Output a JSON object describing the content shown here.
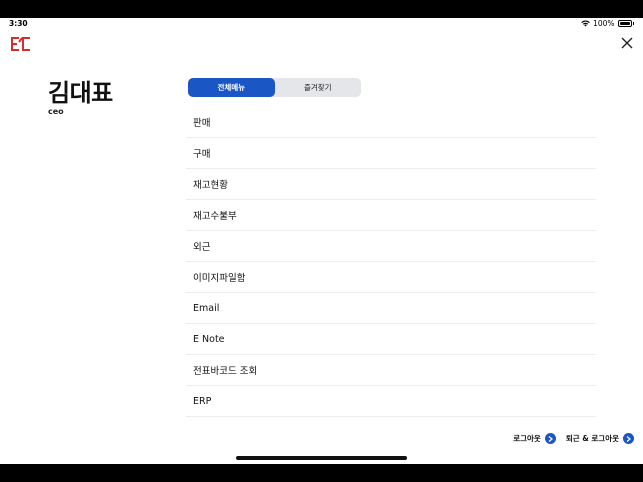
{
  "status_bar": {
    "time": "3:30",
    "battery": "100%"
  },
  "header": {
    "logo_icon": "ec-logo",
    "close_icon": "close-icon"
  },
  "profile": {
    "name": "김대표",
    "role": "ceo"
  },
  "tabs": [
    {
      "label": "전체메뉴",
      "active": true
    },
    {
      "label": "즐겨찾기",
      "active": false
    }
  ],
  "menu": [
    {
      "label": "판매"
    },
    {
      "label": "구매"
    },
    {
      "label": "재고현황"
    },
    {
      "label": "재고수불부"
    },
    {
      "label": "외근"
    },
    {
      "label": "이미지파일함"
    },
    {
      "label": "Email"
    },
    {
      "label": "E Note"
    },
    {
      "label": "전표바코드 조회"
    },
    {
      "label": "ERP"
    }
  ],
  "footer": {
    "logout_label": "로그아웃",
    "leave_logout_label": "퇴근 & 로그아웃"
  },
  "colors": {
    "accent": "#1a56c4",
    "logo_red": "#d32f2f"
  }
}
